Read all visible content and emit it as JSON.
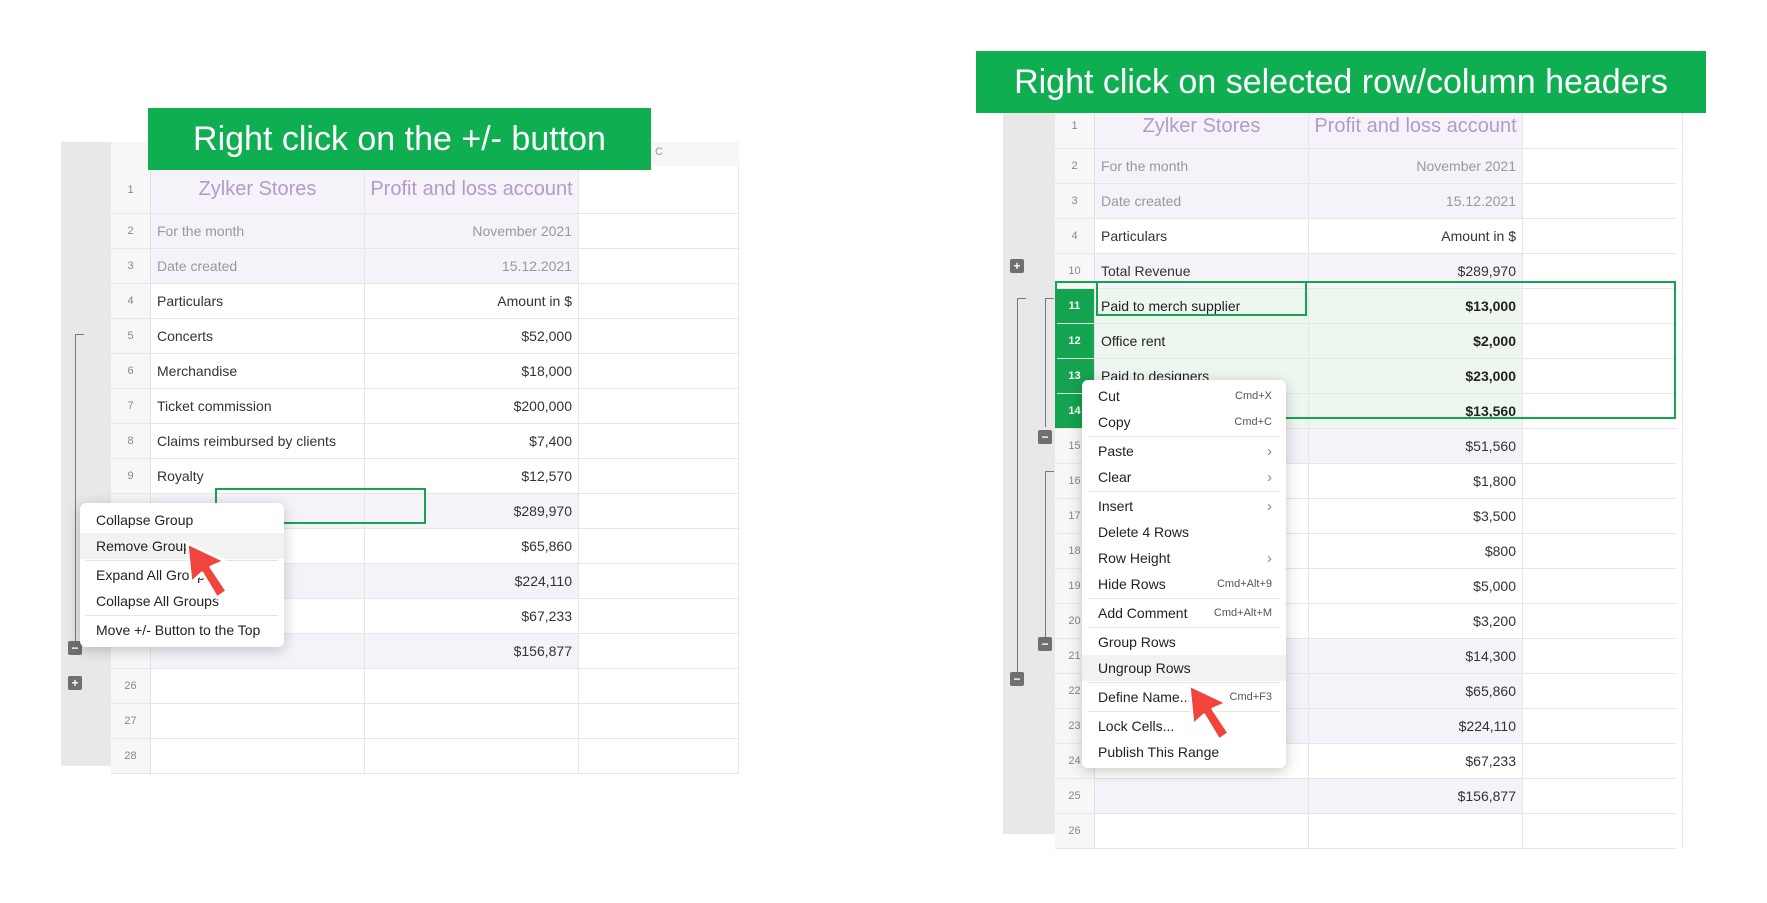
{
  "left_banner": "Right click on the +/- button",
  "right_banner": "Right click on selected row/column headers",
  "left_sheet": {
    "col_header_c": "C",
    "rows": [
      {
        "n": "1",
        "b": "Zylker Stores",
        "c": "Profit and loss account",
        "kind": "title"
      },
      {
        "n": "2",
        "b": "For the month",
        "c": "November 2021",
        "kind": "faded"
      },
      {
        "n": "3",
        "b": "Date created",
        "c": "15.12.2021",
        "kind": "faded"
      },
      {
        "n": "4",
        "b": "Particulars",
        "c": "Amount in $",
        "kind": "plain"
      },
      {
        "n": "5",
        "b": "Concerts",
        "c": "$52,000",
        "kind": "plain"
      },
      {
        "n": "6",
        "b": "Merchandise",
        "c": "$18,000",
        "kind": "plain"
      },
      {
        "n": "7",
        "b": "Ticket commission",
        "c": "$200,000",
        "kind": "plain"
      },
      {
        "n": "8",
        "b": "Claims reimbursed by clients",
        "c": "$7,400",
        "kind": "plain"
      },
      {
        "n": "9",
        "b": "Royalty",
        "c": "$12,570",
        "kind": "plain"
      },
      {
        "n": "",
        "b": "",
        "c": "$289,970",
        "kind": "plain"
      },
      {
        "n": "",
        "b": "",
        "c": "$65,860",
        "kind": "plain"
      },
      {
        "n": "",
        "b": "",
        "c": "$224,110",
        "kind": "plain"
      },
      {
        "n": "",
        "b": "",
        "c": "$67,233",
        "kind": "plain"
      },
      {
        "n": "",
        "b": "",
        "c": "$156,877",
        "kind": "plain"
      },
      {
        "n": "26",
        "b": "",
        "c": "",
        "kind": "plain"
      },
      {
        "n": "27",
        "b": "",
        "c": "",
        "kind": "plain"
      },
      {
        "n": "28",
        "b": "",
        "c": "",
        "kind": "plain"
      }
    ],
    "menu": [
      {
        "label": "Collapse Group"
      },
      {
        "label": "Remove Group"
      },
      {
        "sep": true
      },
      {
        "label": "Expand All Groups"
      },
      {
        "label": "Collapse All Groups"
      },
      {
        "sep": true
      },
      {
        "label": "Move +/- Button to the Top"
      }
    ]
  },
  "right_sheet": {
    "rows": [
      {
        "n": "1",
        "b": "Zylker Stores",
        "c": "Profit and loss account",
        "kind": "title"
      },
      {
        "n": "2",
        "b": "For the month",
        "c": "November 2021",
        "kind": "faded"
      },
      {
        "n": "3",
        "b": "Date created",
        "c": "15.12.2021",
        "kind": "faded"
      },
      {
        "n": "4",
        "b": "Particulars",
        "c": "Amount in $",
        "kind": "plain"
      },
      {
        "n": "10",
        "b": "Total Revenue",
        "c": "$289,970",
        "kind": "plain"
      },
      {
        "n": "11",
        "b": "Paid to merch supplier",
        "c": "$13,000",
        "kind": "sel"
      },
      {
        "n": "12",
        "b": "Office rent",
        "c": "$2,000",
        "kind": "sel"
      },
      {
        "n": "13",
        "b": "Paid to designers",
        "c": "$23,000",
        "kind": "sel"
      },
      {
        "n": "14",
        "b": "",
        "c": "$13,560",
        "kind": "sel"
      },
      {
        "n": "15",
        "b": "",
        "c": "$51,560",
        "kind": "plain"
      },
      {
        "n": "16",
        "b": "",
        "c": "$1,800",
        "kind": "plain"
      },
      {
        "n": "17",
        "b": "",
        "c": "$3,500",
        "kind": "plain"
      },
      {
        "n": "18",
        "b": "",
        "c": "$800",
        "kind": "plain"
      },
      {
        "n": "19",
        "b": "",
        "c": "$5,000",
        "kind": "plain"
      },
      {
        "n": "20",
        "b": "",
        "c": "$3,200",
        "kind": "plain"
      },
      {
        "n": "21",
        "b": "",
        "c": "$14,300",
        "kind": "plain"
      },
      {
        "n": "22",
        "b": "",
        "c": "$65,860",
        "kind": "plain"
      },
      {
        "n": "23",
        "b": "",
        "c": "$224,110",
        "kind": "plain"
      },
      {
        "n": "24",
        "b": "",
        "c": "$67,233",
        "kind": "plain"
      },
      {
        "n": "25",
        "b": "",
        "c": "$156,877",
        "kind": "plain"
      },
      {
        "n": "26",
        "b": "",
        "c": "",
        "kind": "plain"
      }
    ],
    "menu": [
      {
        "label": "Cut",
        "shortcut": "Cmd+X"
      },
      {
        "label": "Copy",
        "shortcut": "Cmd+C"
      },
      {
        "sep": true
      },
      {
        "label": "Paste",
        "arrow": true
      },
      {
        "label": "Clear",
        "arrow": true
      },
      {
        "sep": true
      },
      {
        "label": "Insert",
        "arrow": true
      },
      {
        "label": "Delete 4 Rows"
      },
      {
        "label": "Row Height",
        "arrow": true
      },
      {
        "label": "Hide Rows",
        "shortcut": "Cmd+Alt+9"
      },
      {
        "sep": true
      },
      {
        "label": "Add Comment",
        "shortcut": "Cmd+Alt+M"
      },
      {
        "sep": true
      },
      {
        "label": "Group Rows"
      },
      {
        "label": "Ungroup Rows"
      },
      {
        "sep": true
      },
      {
        "label": "Define Name...",
        "shortcut": "Cmd+F3"
      },
      {
        "sep": true
      },
      {
        "label": "Lock Cells..."
      },
      {
        "label": "Publish This Range"
      }
    ]
  },
  "colors": {
    "banner": "#0fae50",
    "selection": "#14a34e",
    "tint": "#f6f2fa",
    "cursor": "#f0443c"
  }
}
